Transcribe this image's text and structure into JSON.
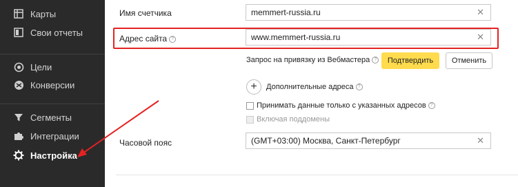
{
  "sidebar": {
    "items": [
      {
        "label": "Карты",
        "icon": "map-icon"
      },
      {
        "label": "Свои отчеты",
        "icon": "custom-reports-icon"
      },
      {
        "label": "Цели",
        "icon": "goals-icon"
      },
      {
        "label": "Конверсии",
        "icon": "conversions-icon"
      },
      {
        "label": "Сегменты",
        "icon": "filter-icon"
      },
      {
        "label": "Интеграции",
        "icon": "puzzle-icon"
      },
      {
        "label": "Настройка",
        "icon": "gear-icon"
      }
    ],
    "active": "Настройка"
  },
  "form": {
    "counter_name_label": "Имя счетчика",
    "counter_name_value": "memmert-russia.ru",
    "site_address_label": "Адрес сайта",
    "site_address_value": "www.memmert-russia.ru",
    "webmaster_request_text": "Запрос на привязку из Вебмастера",
    "confirm_label": "Подтвердить",
    "cancel_label": "Отменить",
    "additional_addresses_label": "Дополнительные адреса",
    "accept_only_label": "Принимать данные только с указанных адресов",
    "include_subdomains_label": "Включая поддомены",
    "timezone_label": "Часовой пояс",
    "timezone_value": "(GMT+03:00) Москва, Санкт-Петербург"
  },
  "colors": {
    "sidebar_bg": "#2a2a2a",
    "accent_yellow": "#ffdb4d",
    "highlight_red": "#e52222"
  }
}
